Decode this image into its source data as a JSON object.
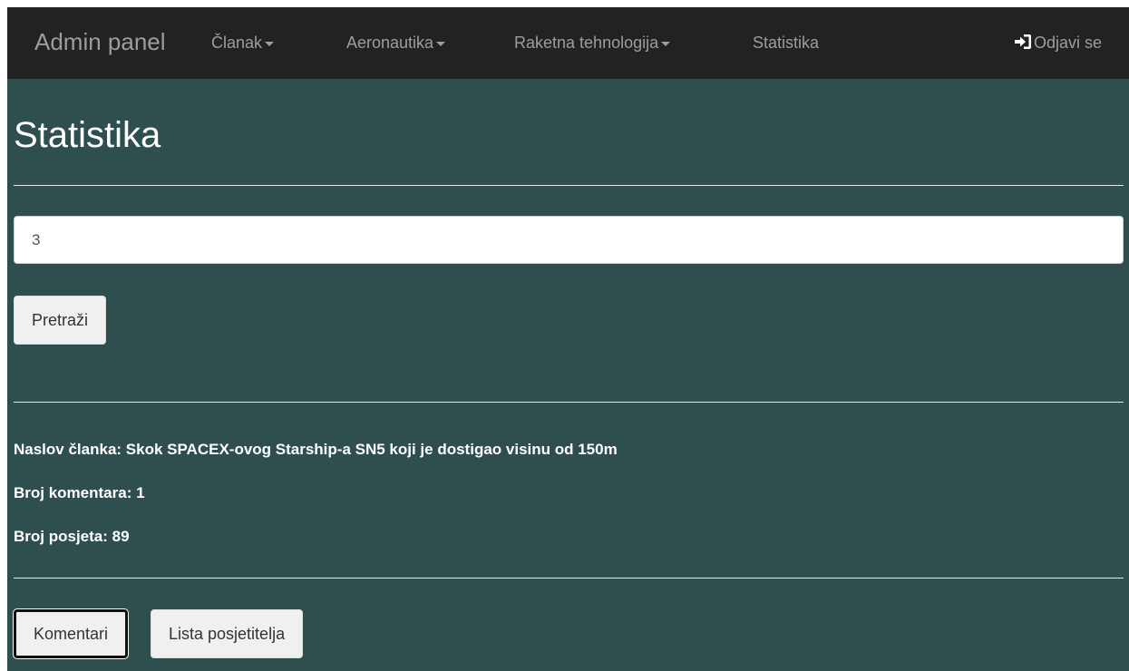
{
  "navbar": {
    "brand": "Admin panel",
    "items": [
      {
        "label": "Članak",
        "has_dropdown": true
      },
      {
        "label": "Aeronautika",
        "has_dropdown": true
      },
      {
        "label": "Raketna tehnologija",
        "has_dropdown": true
      },
      {
        "label": "Statistika",
        "has_dropdown": false
      }
    ],
    "logout_label": "Odjavi se",
    "logout_icon": "log-in-icon"
  },
  "page": {
    "title": "Statistika"
  },
  "search": {
    "value": "3",
    "button_label": "Pretraži"
  },
  "article": {
    "title_line": "Naslov članka: Skok SPACEX-ovog Starship-a SN5 koji je dostigao visinu od 150m",
    "comments_line": "Broj komentara: 1",
    "visits_line": "Broj posjeta: 89"
  },
  "actions": {
    "comments_label": "Komentari",
    "visitors_label": "Lista posjetitelja"
  },
  "colors": {
    "navbar_bg": "#222222",
    "page_bg": "#2f4f4f",
    "nav_text": "#9d9d9d",
    "button_bg": "#f0f0f0"
  }
}
